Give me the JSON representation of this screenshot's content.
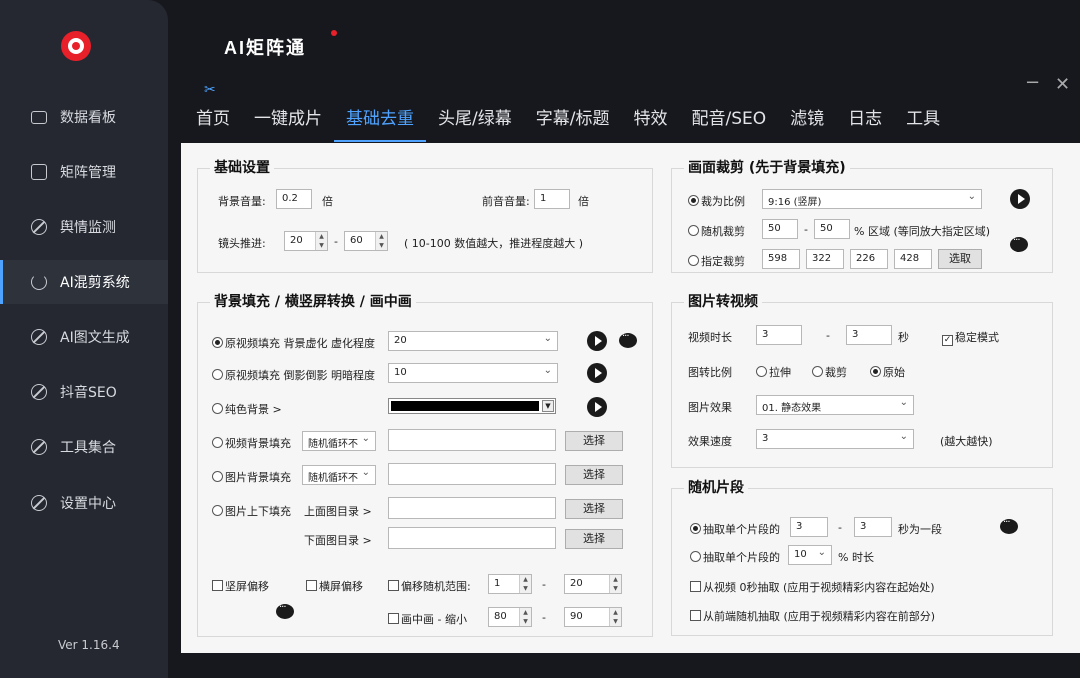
{
  "app": {
    "title": "AI矩阵通",
    "version": "Ver 1.16.4"
  },
  "window": {
    "minimize": "−",
    "close": "✕"
  },
  "sidebar": {
    "items": [
      {
        "label": "数据看板",
        "icon": "monitor-icon"
      },
      {
        "label": "矩阵管理",
        "icon": "box-icon"
      },
      {
        "label": "舆情监测",
        "icon": "circle-slash-icon"
      },
      {
        "label": "AI混剪系统",
        "icon": "refresh-icon",
        "active": true
      },
      {
        "label": "AI图文生成",
        "icon": "circle-slash-icon"
      },
      {
        "label": "抖音SEO",
        "icon": "circle-slash-icon"
      },
      {
        "label": "工具集合",
        "icon": "circle-slash-icon"
      },
      {
        "label": "设置中心",
        "icon": "circle-slash-icon"
      }
    ]
  },
  "tabs": [
    "首页",
    "一键成片",
    "基础去重",
    "头尾/绿幕",
    "字幕/标题",
    "特效",
    "配音/SEO",
    "滤镜",
    "日志",
    "工具"
  ],
  "active_tab": "基础去重",
  "basic": {
    "title": "基础设置",
    "bg_volume_label": "背景音量:",
    "bg_volume": "0.2",
    "bg_volume_unit": "倍",
    "fg_volume_label": "前音音量:",
    "fg_volume": "1",
    "fg_volume_unit": "倍",
    "push_label": "镜头推进:",
    "push_min": "20",
    "push_dash": "-",
    "push_max": "60",
    "push_hint": "( 10-100 数值越大，推进程度越大 )"
  },
  "bgfill": {
    "title": "背景填充 / 横竖屏转换 / 画中画",
    "opt1": "原视频填充 背景虚化 虚化程度",
    "opt1_val": "20",
    "opt2": "原视频填充 倒影倒影 明暗程度",
    "opt2_val": "10",
    "opt3": "纯色背景 >",
    "opt4": "视频背景填充",
    "opt4_sel": "随机循环不",
    "opt5": "图片背景填充",
    "opt5_sel": "随机循环不",
    "opt6": "图片上下填充",
    "top_dir": "上面图目录 >",
    "bottom_dir": "下面图目录 >",
    "choose": "选择",
    "vert_shift": "坚屏偏移",
    "horiz_shift": "横屏偏移",
    "rand_range": "偏移随机范围:",
    "rand_min": "1",
    "rand_max": "20",
    "pip": "画中画 - 缩小",
    "pip_min": "80",
    "pip_max": "90",
    "dash": "-"
  },
  "crop": {
    "title": "画面裁剪 (先于背景填充)",
    "ratio_label": "裁为比例",
    "ratio_val": "9:16 (竖屏)",
    "random_label": "随机裁剪",
    "random_min": "50",
    "random_max": "50",
    "random_hint": "% 区域 (等同放大指定区域)",
    "fixed_label": "指定裁剪",
    "fixed_vals": [
      "598",
      "322",
      "226",
      "428"
    ],
    "pick": "选取",
    "dash": "-"
  },
  "img2video": {
    "title": "图片转视频",
    "duration_label": "视频时长",
    "dur_min": "3",
    "dur_max": "3",
    "dur_unit": "秒",
    "dash": "-",
    "stable": "稳定模式",
    "ratio_label": "图转比例",
    "ratio_opts": [
      "拉伸",
      "裁剪",
      "原始"
    ],
    "effect_label": "图片效果",
    "effect_val": "01. 静态效果",
    "speed_label": "效果速度",
    "speed_val": "3",
    "speed_hint": "(越大越快)"
  },
  "segment": {
    "title": "随机片段",
    "opt1": "抽取单个片段的",
    "opt1_min": "3",
    "opt1_max": "3",
    "opt1_unit": "秒为一段",
    "opt2": "抽取单个片段的",
    "opt2_val": "10",
    "opt2_unit": "% 时长",
    "chk1": "从视频 0秒抽取 (应用于视频精彩内容在起始处)",
    "chk2": "从前端随机抽取 (应用于视频精彩内容在前部分)",
    "dash": "-"
  }
}
